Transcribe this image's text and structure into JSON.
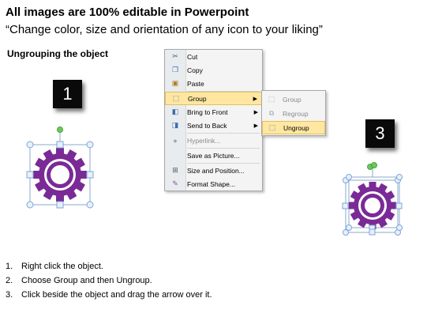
{
  "header": {
    "title": "All images are 100% editable in Powerpoint",
    "subtitle": "“Change color, size and orientation of any icon to your liking”"
  },
  "section_label": "Ungrouping the object",
  "steps": {
    "step1": "1",
    "step3": "3"
  },
  "context_menu": {
    "items": [
      {
        "label": "Cut",
        "icon": "scissors-icon"
      },
      {
        "label": "Copy",
        "icon": "copy-icon"
      },
      {
        "label": "Paste",
        "icon": "paste-icon"
      },
      {
        "label": "Group",
        "icon": "group-icon",
        "highlighted": true,
        "submenu": true
      },
      {
        "label": "Bring to Front",
        "icon": "bring-to-front-icon",
        "submenu": true
      },
      {
        "label": "Send to Back",
        "icon": "send-to-back-icon",
        "submenu": true
      },
      {
        "label": "Hyperlink...",
        "icon": "hyperlink-icon",
        "disabled": true
      },
      {
        "label": "Save as Picture...",
        "icon": ""
      },
      {
        "label": "Size and Position...",
        "icon": "size-position-icon"
      },
      {
        "label": "Format Shape...",
        "icon": "format-shape-icon"
      }
    ]
  },
  "group_submenu": {
    "items": [
      {
        "label": "Group",
        "icon": "group-icon",
        "disabled": true
      },
      {
        "label": "Regroup",
        "icon": "regroup-icon",
        "disabled": true
      },
      {
        "label": "Ungroup",
        "icon": "ungroup-icon",
        "highlighted": true
      }
    ]
  },
  "instructions": [
    {
      "num": "1.",
      "text": "Right click the object."
    },
    {
      "num": "2.",
      "text": "Choose Group and then Ungroup."
    },
    {
      "num": "3.",
      "text": "Click beside the object and drag the arrow over it."
    }
  ],
  "colors": {
    "gear_fill": "#7a2a96",
    "gear_dark": "#5b1d73",
    "gear_inner_ring": "#ffffff",
    "handle_color": "#7ea6d8",
    "rotate_handle": "#66cc55",
    "menu_highlight": "#ffe7a2"
  }
}
